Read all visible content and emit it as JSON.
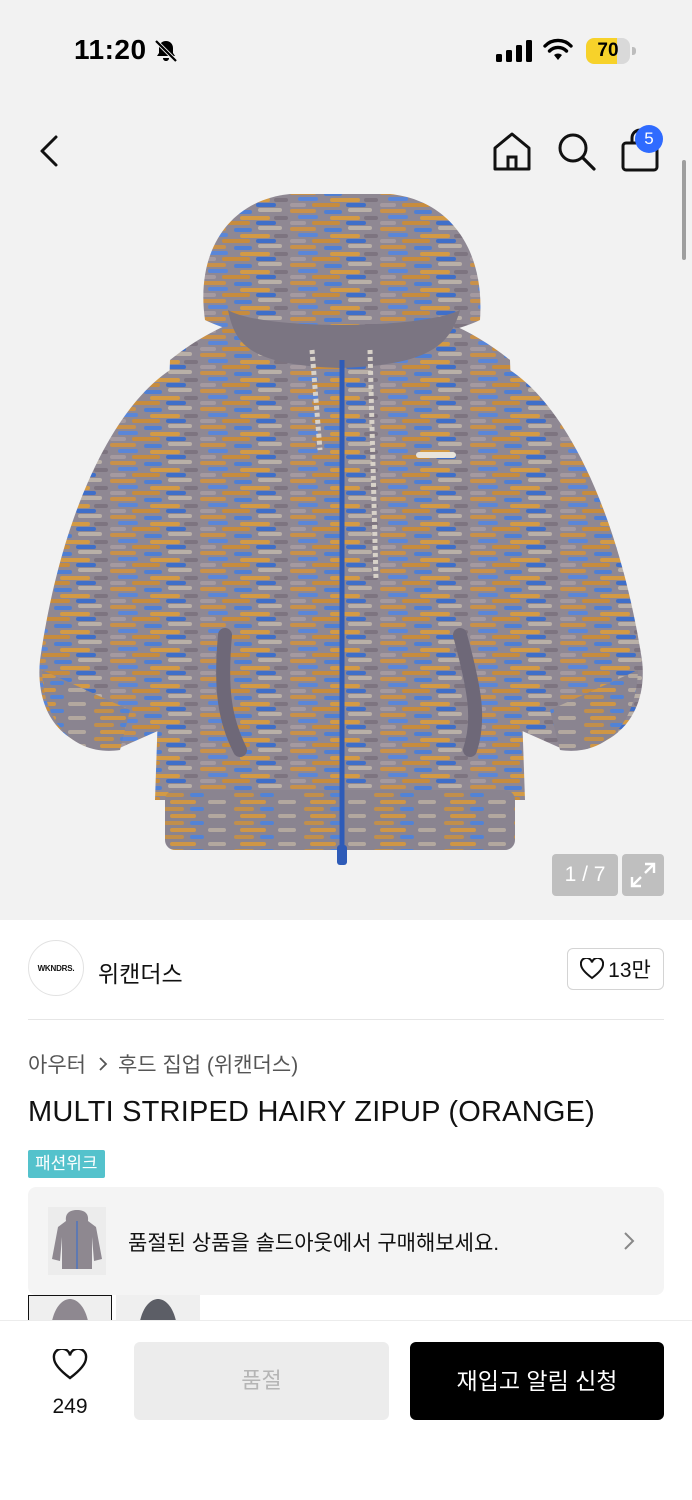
{
  "status_bar": {
    "time": "11:20",
    "battery_level": "70",
    "battery_fraction": 0.7
  },
  "header": {
    "cart_count": "5"
  },
  "gallery": {
    "counter": "1 / 7",
    "current": 1,
    "total": 7
  },
  "brand": {
    "logo_text": "WKNDRS.",
    "name": "위캔더스",
    "likes": "13만"
  },
  "product": {
    "breadcrumb": [
      "아우터",
      "후드 집업 (위캔더스)"
    ],
    "title": "MULTI STRIPED HAIRY ZIPUP (ORANGE)",
    "event_badge": "패션위크"
  },
  "soldout_banner": {
    "text": "품절된 상품을 솔드아웃에서 구매해보세요."
  },
  "bottom_bar": {
    "wish_count": "249",
    "soldout_label": "품절",
    "restock_label": "재입고 알림 신청"
  },
  "colors": {
    "accent_blue": "#2f6bff",
    "badge_teal": "#54c2cc",
    "primary_black": "#000000"
  }
}
